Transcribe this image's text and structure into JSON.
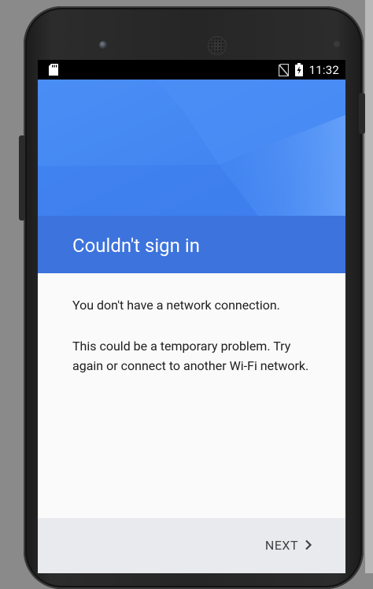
{
  "status_bar": {
    "time": "11:32",
    "icons": [
      "sd-card-icon",
      "no-sim-icon",
      "battery-charging-icon"
    ]
  },
  "header": {
    "title": "Couldn't sign in",
    "colors": {
      "primary": "#4285f4",
      "band": "#3d73dc"
    }
  },
  "content": {
    "paragraphs": [
      "You don't have a network connection.",
      "This could be a temporary problem. Try again or connect to another Wi-Fi network."
    ]
  },
  "footer": {
    "next_label": "NEXT",
    "next_icon": "chevron-right-icon"
  }
}
